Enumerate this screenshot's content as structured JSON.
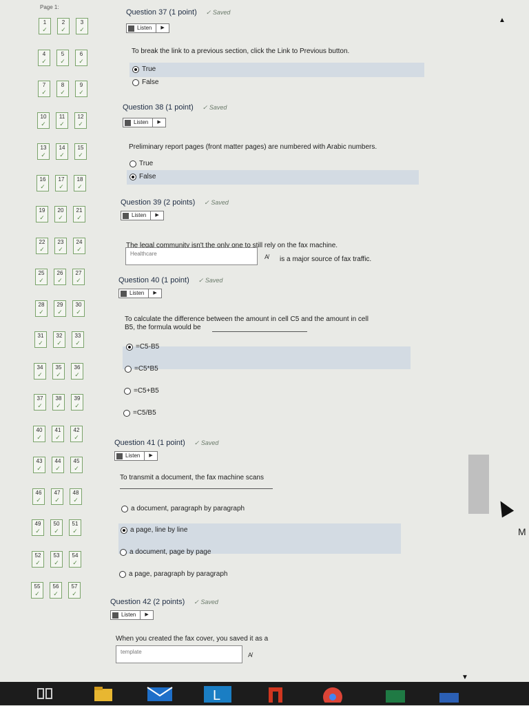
{
  "page_label": "Page 1:",
  "navigator": {
    "cells": [
      "1",
      "2",
      "3",
      "4",
      "5",
      "6",
      "7",
      "8",
      "9",
      "10",
      "11",
      "12",
      "13",
      "14",
      "15",
      "16",
      "17",
      "18",
      "19",
      "20",
      "21",
      "22",
      "23",
      "24",
      "25",
      "26",
      "27",
      "28",
      "29",
      "30",
      "31",
      "32",
      "33",
      "34",
      "35",
      "36",
      "37",
      "38",
      "39",
      "40",
      "41",
      "42",
      "43",
      "44",
      "45",
      "46",
      "47",
      "48",
      "49",
      "50",
      "51",
      "52",
      "53",
      "54",
      "55",
      "56",
      "57"
    ],
    "check": "✓"
  },
  "listen_label": "Listen",
  "saved_label": "Saved",
  "questions": {
    "q37": {
      "title": "Question 37 (1 point)",
      "text": "To break the link to a previous section, click the Link to Previous button.",
      "options": [
        "True",
        "False"
      ],
      "selected": 0
    },
    "q38": {
      "title": "Question 38 (1 point)",
      "text": "Preliminary report pages (front matter pages) are numbered with Arabic numbers.",
      "options": [
        "True",
        "False"
      ],
      "selected": 1
    },
    "q39": {
      "title": "Question 39 (2 points)",
      "text": "The legal community isn't the only one to still rely on the fax machine.",
      "input_value": "Healthcare",
      "after_text": "is a major source of fax traffic."
    },
    "q40": {
      "title": "Question 40 (1 point)",
      "text_line1": "To calculate the difference between the amount in cell C5 and the amount in cell",
      "text_line2": "B5, the formula would be",
      "options": [
        "=C5-B5",
        "=C5*B5",
        "=C5+B5",
        "=C5/B5"
      ],
      "selected": 0
    },
    "q41": {
      "title": "Question 41 (1 point)",
      "text": "To transmit a document, the fax machine scans",
      "options": [
        "a document, paragraph by paragraph",
        "a page, line by line",
        "a document, page by page",
        "a page, paragraph by paragraph"
      ],
      "selected": 1
    },
    "q42": {
      "title": "Question 42 (2 points)",
      "text": "When you created the fax cover, you saved it as a",
      "input_value": "template"
    }
  },
  "side_letter": "M",
  "colors": {
    "highlight": "#d3dbe3",
    "nav_border": "#7aa36a",
    "taskbar": "#1c1c1c"
  }
}
